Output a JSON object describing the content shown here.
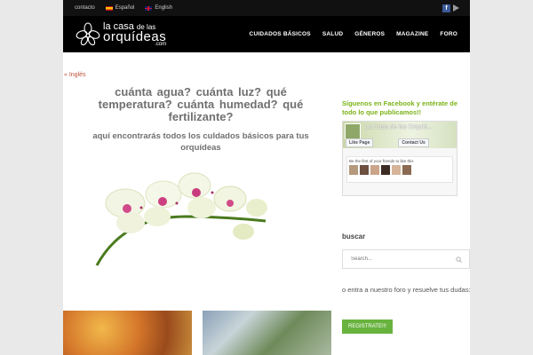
{
  "topbar": {
    "contact": "contacto",
    "espanol": "Español",
    "english": "English",
    "fb_letter": "f"
  },
  "header": {
    "logo_line1_a": "la casa",
    "logo_line1_b": "de las",
    "logo_line2": "orquídeas",
    "logo_line3": ".com",
    "nav": [
      "CUIDADOS BÁSICOS",
      "SALUD",
      "GÉNEROS",
      "MAGAZINE",
      "FORO"
    ]
  },
  "main": {
    "lang_link": "« Inglés",
    "heading": "cuánta agua?   cuánta luz?   qué temperatura?   cuánta humedad?   qué fertilizante?",
    "subheading": "aquí encontrarás todos los culdados básicos para tus orquídeas"
  },
  "sidebar": {
    "fb_title": "Síguenos en Facebook y entérate de todo lo que publicamos!!",
    "fb_page_name": "La Casa de las Orquíd...",
    "fb_like": "Like Page",
    "fb_contact": "Contact Us",
    "fb_friends_text": "Be the first of your friends to like this",
    "search_title": "buscar",
    "search_placeholder": "Search...",
    "foro_text": "o entra a nuestro foro y resuelve tus dudas:",
    "register_label": "REGISTRATE!!!"
  },
  "colors": {
    "accent_green": "#7ab317",
    "button_green": "#68b33e",
    "link_orange": "#c0513a",
    "header_bg": "#000000"
  }
}
